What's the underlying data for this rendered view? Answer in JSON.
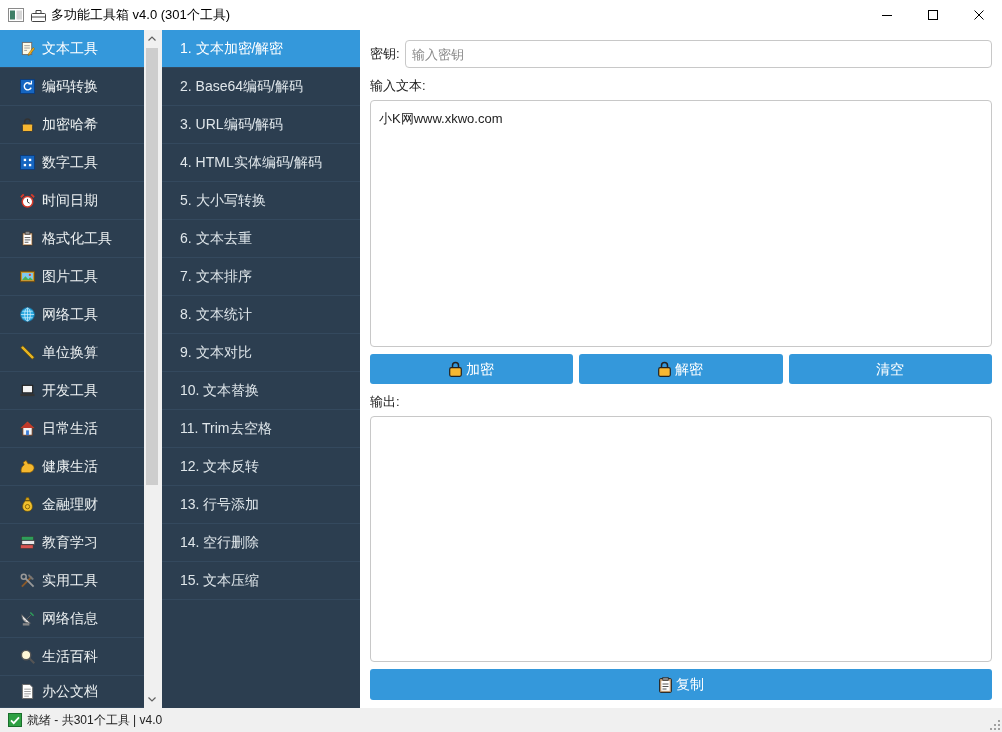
{
  "window": {
    "title": "多功能工具箱 v4.0 (301个工具)"
  },
  "categories": [
    {
      "label": "文本工具",
      "selected": true
    },
    {
      "label": "编码转换",
      "selected": false
    },
    {
      "label": "加密哈希",
      "selected": false
    },
    {
      "label": "数字工具",
      "selected": false
    },
    {
      "label": "时间日期",
      "selected": false
    },
    {
      "label": "格式化工具",
      "selected": false
    },
    {
      "label": "图片工具",
      "selected": false
    },
    {
      "label": "网络工具",
      "selected": false
    },
    {
      "label": "单位换算",
      "selected": false
    },
    {
      "label": "开发工具",
      "selected": false
    },
    {
      "label": "日常生活",
      "selected": false
    },
    {
      "label": "健康生活",
      "selected": false
    },
    {
      "label": "金融理财",
      "selected": false
    },
    {
      "label": "教育学习",
      "selected": false
    },
    {
      "label": "实用工具",
      "selected": false
    },
    {
      "label": "网络信息",
      "selected": false
    },
    {
      "label": "生活百科",
      "selected": false
    },
    {
      "label": "办公文档",
      "selected": false
    }
  ],
  "tools": [
    {
      "label": "1. 文本加密/解密",
      "selected": true
    },
    {
      "label": "2. Base64编码/解码",
      "selected": false
    },
    {
      "label": "3. URL编码/解码",
      "selected": false
    },
    {
      "label": "4. HTML实体编码/解码",
      "selected": false
    },
    {
      "label": "5. 大小写转换",
      "selected": false
    },
    {
      "label": "6. 文本去重",
      "selected": false
    },
    {
      "label": "7. 文本排序",
      "selected": false
    },
    {
      "label": "8. 文本统计",
      "selected": false
    },
    {
      "label": "9. 文本对比",
      "selected": false
    },
    {
      "label": "10. 文本替换",
      "selected": false
    },
    {
      "label": "11. Trim去空格",
      "selected": false
    },
    {
      "label": "12. 文本反转",
      "selected": false
    },
    {
      "label": "13. 行号添加",
      "selected": false
    },
    {
      "label": "14. 空行删除",
      "selected": false
    },
    {
      "label": "15. 文本压缩",
      "selected": false
    }
  ],
  "key_field": {
    "label": "密钥:",
    "placeholder": "输入密钥"
  },
  "input": {
    "label": "输入文本:",
    "value": "小K网www.xkwo.com"
  },
  "actions": [
    {
      "label": "加密",
      "kind": "icon"
    },
    {
      "label": "解密",
      "kind": "icon"
    },
    {
      "label": "清空",
      "kind": "text"
    }
  ],
  "output": {
    "label": "输出:"
  },
  "copy_button": {
    "label": "复制"
  },
  "status_bar": {
    "text": "就绪 - 共301个工具 | v4.0"
  }
}
